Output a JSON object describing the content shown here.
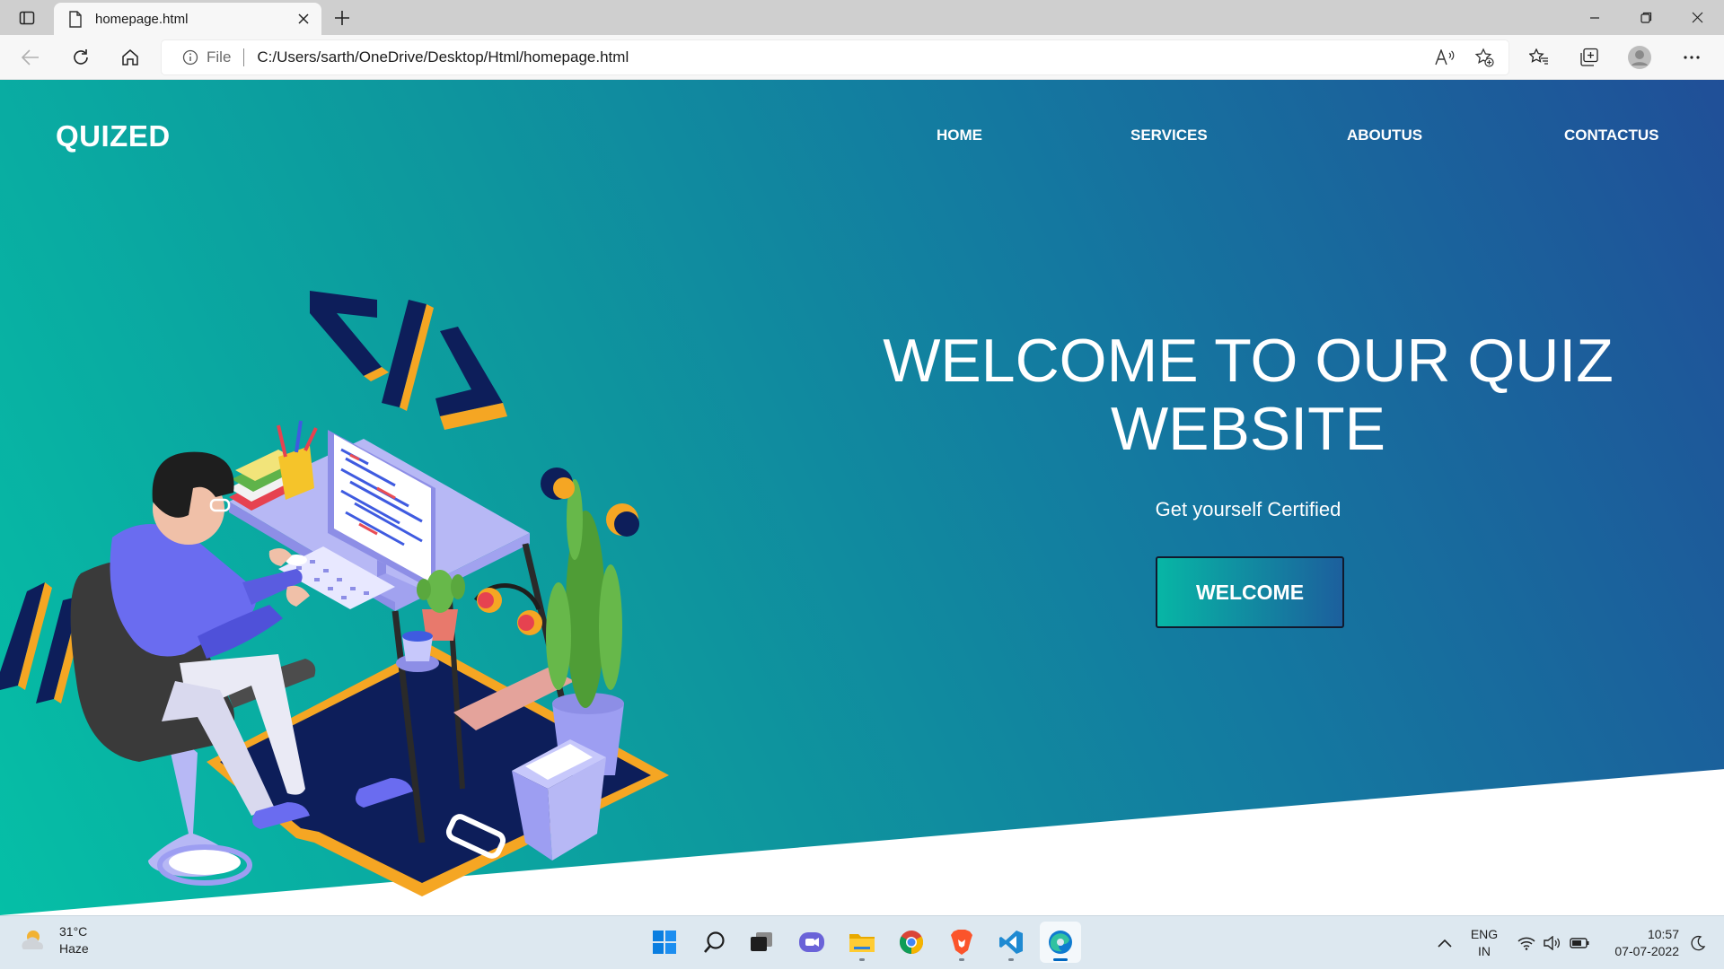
{
  "browser": {
    "tab_title": "homepage.html",
    "site_label": "File",
    "url": "C:/Users/sarth/OneDrive/Desktop/Html/homepage.html"
  },
  "site": {
    "logo": "QUIZED",
    "nav": [
      "HOME",
      "SERVICES",
      "ABOUTUS",
      "CONTACTUS"
    ],
    "hero_title": "WELCOME TO OUR QUIZ WEBSITE",
    "hero_subtitle": "Get yourself Certified",
    "hero_button": "WELCOME"
  },
  "taskbar": {
    "weather_temp": "31°C",
    "weather_desc": "Haze",
    "lang_top": "ENG",
    "lang_bottom": "IN",
    "time": "10:57",
    "date": "07-07-2022"
  },
  "colors": {
    "hero_gradient_start": "#05bfa6",
    "hero_gradient_end": "#204f98",
    "accent_orange": "#f5a623",
    "navy": "#0d1e5a"
  },
  "icons": [
    "tab-actions-icon",
    "file-icon",
    "close-icon",
    "plus-icon",
    "minimize-icon",
    "restore-icon",
    "back-icon",
    "refresh-icon",
    "home-icon",
    "info-icon",
    "read-aloud-icon",
    "add-favorite-icon",
    "favorites-icon",
    "collections-icon",
    "profile-icon",
    "more-icon",
    "weather-icon",
    "windows-start-icon",
    "search-icon",
    "task-view-icon",
    "chat-icon",
    "file-explorer-icon",
    "chrome-icon",
    "brave-icon",
    "vscode-icon",
    "edge-icon",
    "chevron-up-icon",
    "wifi-icon",
    "volume-icon",
    "battery-icon",
    "do-not-disturb-icon"
  ]
}
